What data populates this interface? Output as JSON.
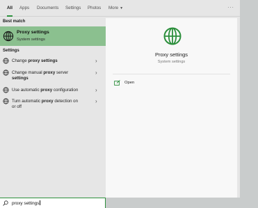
{
  "tabs": [
    {
      "label": "All",
      "active": true
    },
    {
      "label": "Apps"
    },
    {
      "label": "Documents"
    },
    {
      "label": "Settings"
    },
    {
      "label": "Photos"
    },
    {
      "label": "More"
    }
  ],
  "ellipsis": "···",
  "best_match": {
    "section_label": "Best match",
    "title": "Proxy settings",
    "subtitle": "System settings",
    "icon": "globe-icon"
  },
  "settings_section": {
    "label": "Settings",
    "items": [
      {
        "prefix": "Change ",
        "bold": "proxy settings",
        "suffix": "",
        "icon": "globe-icon"
      },
      {
        "prefix": "Change manual ",
        "bold": "proxy",
        "suffix": " server",
        "line2_bold": "settings",
        "icon": "globe-icon"
      },
      {
        "prefix": "Use automatic ",
        "bold": "proxy",
        "suffix": " configuration",
        "icon": "globe-icon"
      },
      {
        "prefix": "Turn automatic ",
        "bold": "proxy",
        "suffix": " detection on",
        "line2": "or off",
        "icon": "globe-icon"
      }
    ]
  },
  "preview": {
    "title": "Proxy settings",
    "subtitle": "System settings",
    "actions": [
      {
        "label": "Open",
        "icon": "open-icon"
      }
    ]
  },
  "search": {
    "value": "proxy settings",
    "icon": "search-icon"
  },
  "colors": {
    "accent": "#2c8f3c",
    "best_match_bg": "#8bc08f",
    "panel_bg": "#e6e6e6",
    "preview_bg": "#f8f8f8"
  }
}
